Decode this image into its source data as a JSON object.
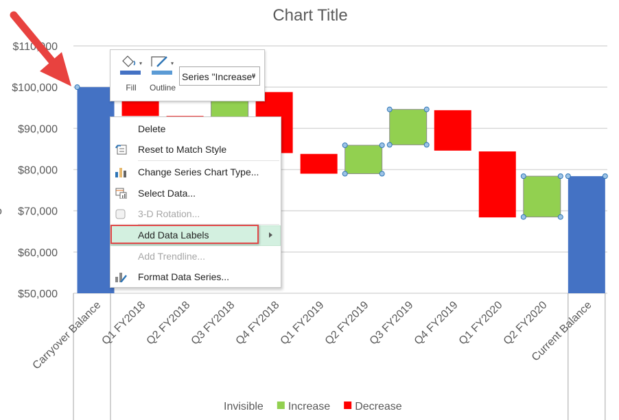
{
  "chart_data": {
    "type": "bar",
    "subtype": "stacked-waterfall",
    "title": "Chart Title",
    "xlabel": "",
    "ylabel": "",
    "ylim": [
      50000,
      110000
    ],
    "yticks": [
      50000,
      60000,
      70000,
      80000,
      90000,
      100000,
      110000
    ],
    "ytick_labels": [
      "$50,000",
      "$60,000",
      "$70,000",
      "$80,000",
      "$90,000",
      "$100,000",
      "$110,000"
    ],
    "grid": true,
    "categories": [
      "Carryover Balance",
      "Q1 FY2018",
      "Q2 FY2018",
      "Q3 FY2018",
      "Q4 FY2018",
      "Q1 FY2019",
      "Q2 FY2019",
      "Q3 FY2019",
      "Q4 FY2019",
      "Q1 FY2020",
      "Q2 FY2020",
      "Current Balance"
    ],
    "series": [
      {
        "name": "Invisible",
        "color": null,
        "values": [
          0,
          93000,
          88000,
          88000,
          84000,
          79000,
          79000,
          86000,
          84600,
          68400,
          68500,
          0
        ]
      },
      {
        "name": "Increase",
        "color": "#92d050",
        "values": [
          0,
          0,
          0,
          10800,
          0,
          0,
          6900,
          8600,
          0,
          0,
          9900,
          0
        ]
      },
      {
        "name": "Decrease",
        "color": "#ff0000",
        "values": [
          0,
          7000,
          5000,
          0,
          14800,
          4800,
          0,
          0,
          9800,
          16000,
          0,
          0
        ]
      },
      {
        "name": "Balance",
        "color": "#4472c4",
        "values": [
          100000,
          0,
          0,
          0,
          0,
          0,
          0,
          0,
          0,
          0,
          0,
          78400
        ]
      }
    ],
    "legend": {
      "position": "bottom",
      "entries": [
        {
          "label": "Invisible",
          "color": null
        },
        {
          "label": "Increase",
          "color": "#92d050"
        },
        {
          "label": "Decrease",
          "color": "#ff0000"
        }
      ]
    },
    "selected_series": "Increase"
  },
  "mini_toolbar": {
    "fill_label": "Fill",
    "outline_label": "Outline",
    "series_select": "Series \"Increase\"",
    "fill_color": "#4472c4",
    "outline_color": "#5b9bd5"
  },
  "context_menu": {
    "items": [
      {
        "label": "Delete",
        "icon": null,
        "disabled": false
      },
      {
        "label": "Reset to Match Style",
        "icon": "reset-style-icon",
        "disabled": false
      },
      {
        "label": "Change Series Chart Type...",
        "icon": "chart-type-icon",
        "disabled": false
      },
      {
        "label": "Select Data...",
        "icon": "select-data-icon",
        "disabled": false
      },
      {
        "label": "3-D Rotation...",
        "icon": "rotation-3d-icon",
        "disabled": true
      },
      {
        "label": "Add Data Labels",
        "icon": null,
        "disabled": false,
        "highlighted": true,
        "submenu": true
      },
      {
        "label": "Add Trendline...",
        "icon": null,
        "disabled": true
      },
      {
        "label": "Format Data Series...",
        "icon": "format-series-icon",
        "disabled": false
      }
    ]
  },
  "annotation": {
    "arrow_color": "#e8423f",
    "highlight_color": "#e14848"
  }
}
